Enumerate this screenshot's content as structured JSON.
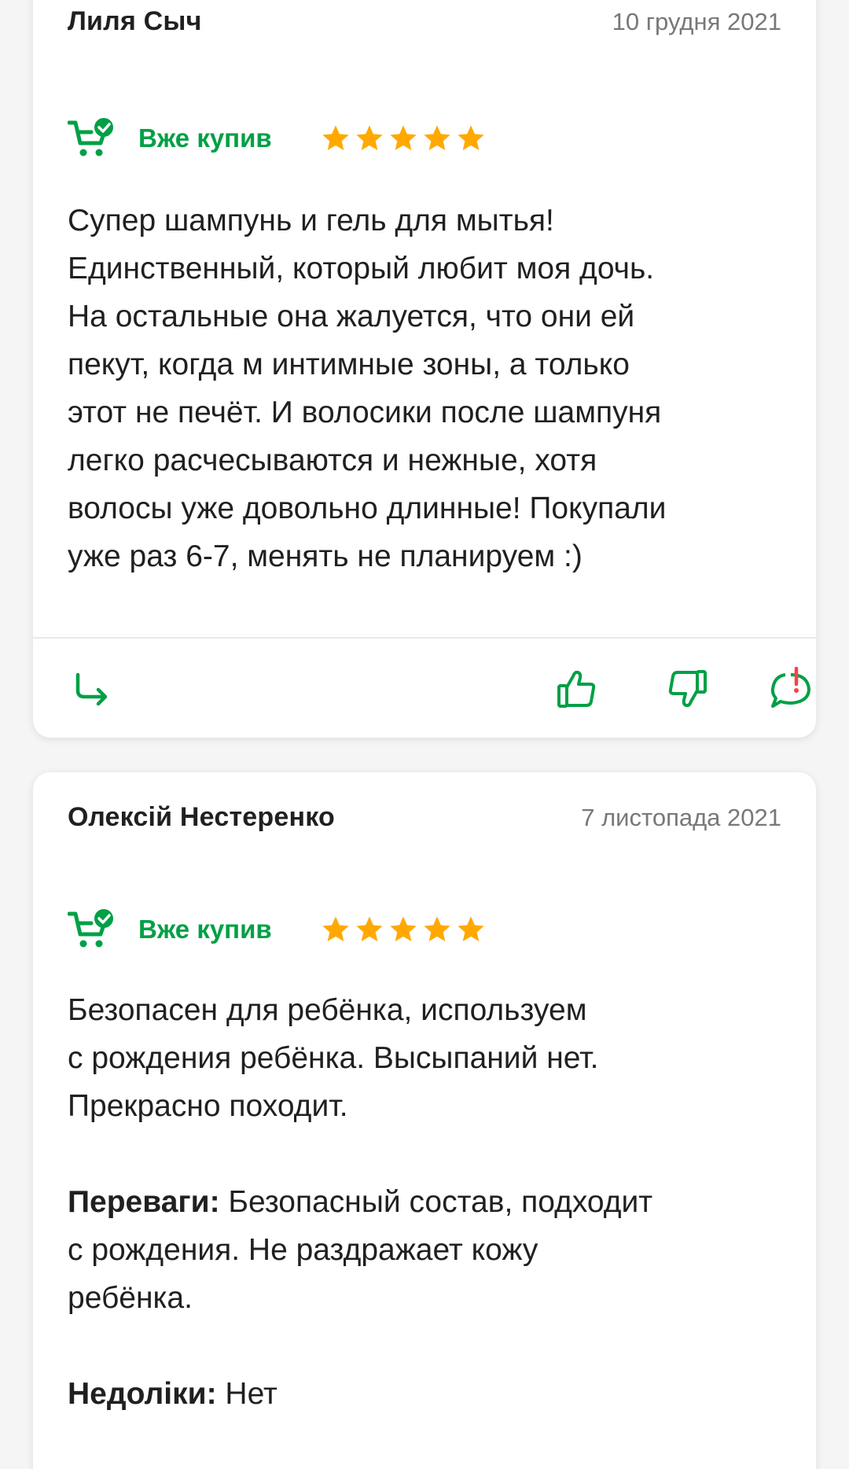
{
  "reviews": [
    {
      "author": "Лиля Сыч",
      "date": "10 грудня 2021",
      "bought_label": "Вже купив",
      "rating": 5,
      "text_lines": [
        "Супер шампунь и гель для мытья!",
        "Единственный, который любит моя дочь.",
        "На остальные она жалуется, что они ей",
        "пекут, когда м интимные зоны, а только",
        "этот не печёт. И волосики после шампуня",
        "легко расчесываются и нежные, хотя",
        "волосы уже довольно длинные! Покупали",
        "уже раз 6-7, менять не планируем :)"
      ]
    },
    {
      "author": "Олексій Нестеренко",
      "date": "7 листопада 2021",
      "bought_label": "Вже купив",
      "rating": 5,
      "text_lines": [
        "Безопасен для ребёнка, используем",
        "с рождения ребёнка. Высыпаний нет.",
        "Прекрасно походит."
      ],
      "pros_label": "Переваги:",
      "pros_lines": [
        " Безопасный состав, подходит",
        "с рождения. Не раздражает кожу",
        "ребёнка."
      ],
      "cons_label": "Недоліки:",
      "cons_text": " Нет"
    }
  ],
  "icons": {
    "reply": "reply-arrow-icon",
    "like": "thumb-up-icon",
    "dislike": "thumb-down-icon",
    "report": "report-complaint-icon",
    "bought": "cart-check-icon",
    "star": "star-icon"
  },
  "colors": {
    "accent_green": "#00a046",
    "star_orange": "#ffa900",
    "report_red": "#f84147",
    "text_dark": "#221f1f",
    "text_muted": "#797878"
  }
}
